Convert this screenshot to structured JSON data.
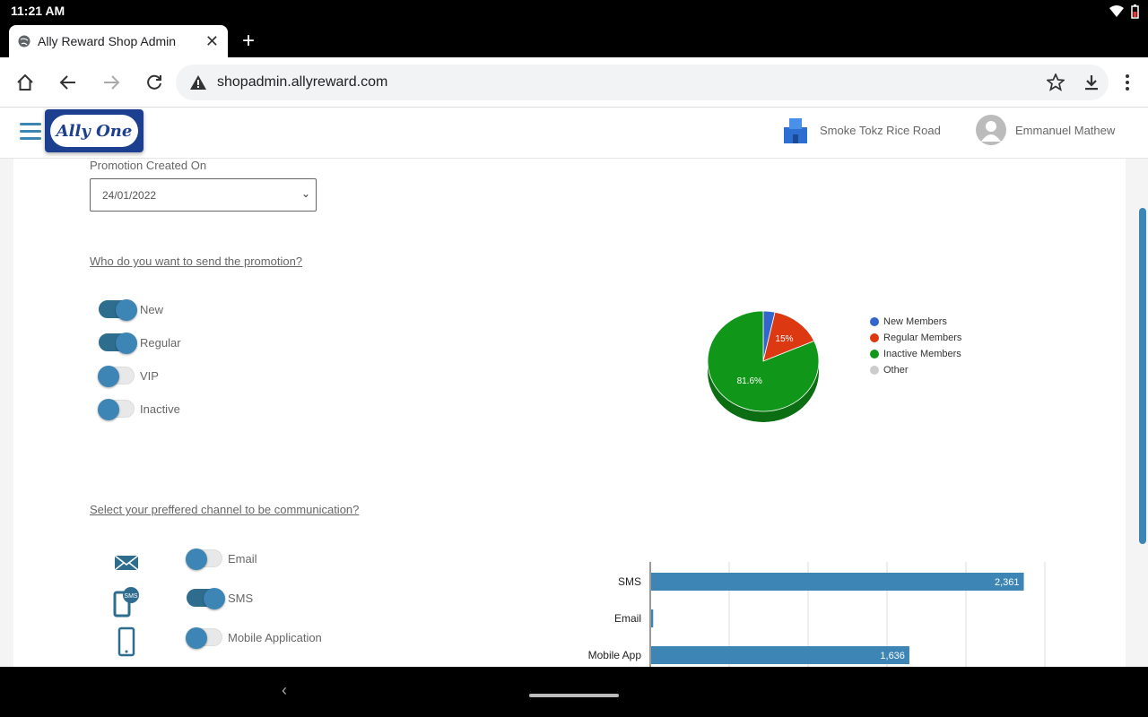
{
  "status": {
    "time": "11:21 AM"
  },
  "browser": {
    "tab_title": "Ally Reward Shop Admin",
    "url": "shopadmin.allyreward.com"
  },
  "header": {
    "logo_text": "Ally One",
    "shop_name": "Smoke Tokz Rice Road",
    "user_name": "Emmanuel Mathew"
  },
  "form": {
    "created_label": "Promotion Created On",
    "created_value": "24/01/2022",
    "audience_question": "Who do you want to send the promotion?",
    "audience": [
      {
        "label": "New",
        "on": true
      },
      {
        "label": "Regular",
        "on": true
      },
      {
        "label": "VIP",
        "on": false
      },
      {
        "label": "Inactive",
        "on": false
      }
    ],
    "channel_question": "Select your preffered channel to be communication?",
    "channels": [
      {
        "label": "Email",
        "on": false,
        "icon": "envelope-icon"
      },
      {
        "label": "SMS",
        "on": true,
        "icon": "sms-phone-icon"
      },
      {
        "label": "Mobile Application",
        "on": false,
        "icon": "mobile-phone-icon"
      }
    ]
  },
  "colors": {
    "accent": "#3d85b5",
    "new_members": "#3366cc",
    "regular_members": "#dc3912",
    "inactive_members": "#109618",
    "other": "#cccccc",
    "bar": "#3d85b5"
  },
  "chart_data": [
    {
      "type": "pie",
      "categories": [
        "New Members",
        "Regular Members",
        "Inactive Members",
        "Other"
      ],
      "values": [
        3.4,
        15,
        81.6,
        0
      ],
      "data_labels": [
        "",
        "15%",
        "81.6%",
        ""
      ],
      "legend": "right",
      "style": "3d"
    },
    {
      "type": "bar",
      "orientation": "horizontal",
      "categories": [
        "SMS",
        "Email",
        "Mobile App"
      ],
      "values": [
        2361,
        13,
        1636
      ],
      "data_labels": [
        "2,361",
        "13",
        "1,636"
      ],
      "xlim": [
        0,
        2500
      ],
      "grid": true
    }
  ]
}
